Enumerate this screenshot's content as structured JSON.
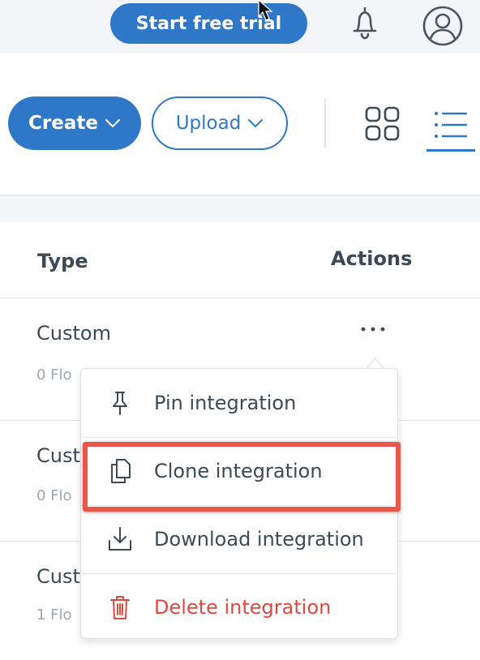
{
  "header": {
    "trial_button": "Start free trial",
    "icons": [
      "bell-icon",
      "avatar-icon"
    ]
  },
  "toolbar": {
    "create_label": "Create",
    "upload_label": "Upload",
    "view_modes": [
      "grid-view",
      "list-view"
    ],
    "active_view": "list-view"
  },
  "table": {
    "columns": [
      "Type",
      "Actions"
    ],
    "rows": [
      {
        "type": "Custom",
        "flows": "0 Flo"
      },
      {
        "type": "Cust",
        "flows": "0 Flo"
      },
      {
        "type": "Cust",
        "flows": "1 Flo"
      }
    ]
  },
  "menu": {
    "items": [
      {
        "label": "Pin integration",
        "icon": "pin-icon"
      },
      {
        "label": "Clone integration",
        "icon": "clone-icon",
        "highlighted": true
      },
      {
        "label": "Download integration",
        "icon": "download-icon"
      },
      {
        "label": "Delete integration",
        "icon": "trash-icon",
        "danger": true
      }
    ]
  },
  "colors": {
    "primary": "#2f78c8",
    "danger": "#e0493f",
    "highlight": "#e9574a"
  }
}
